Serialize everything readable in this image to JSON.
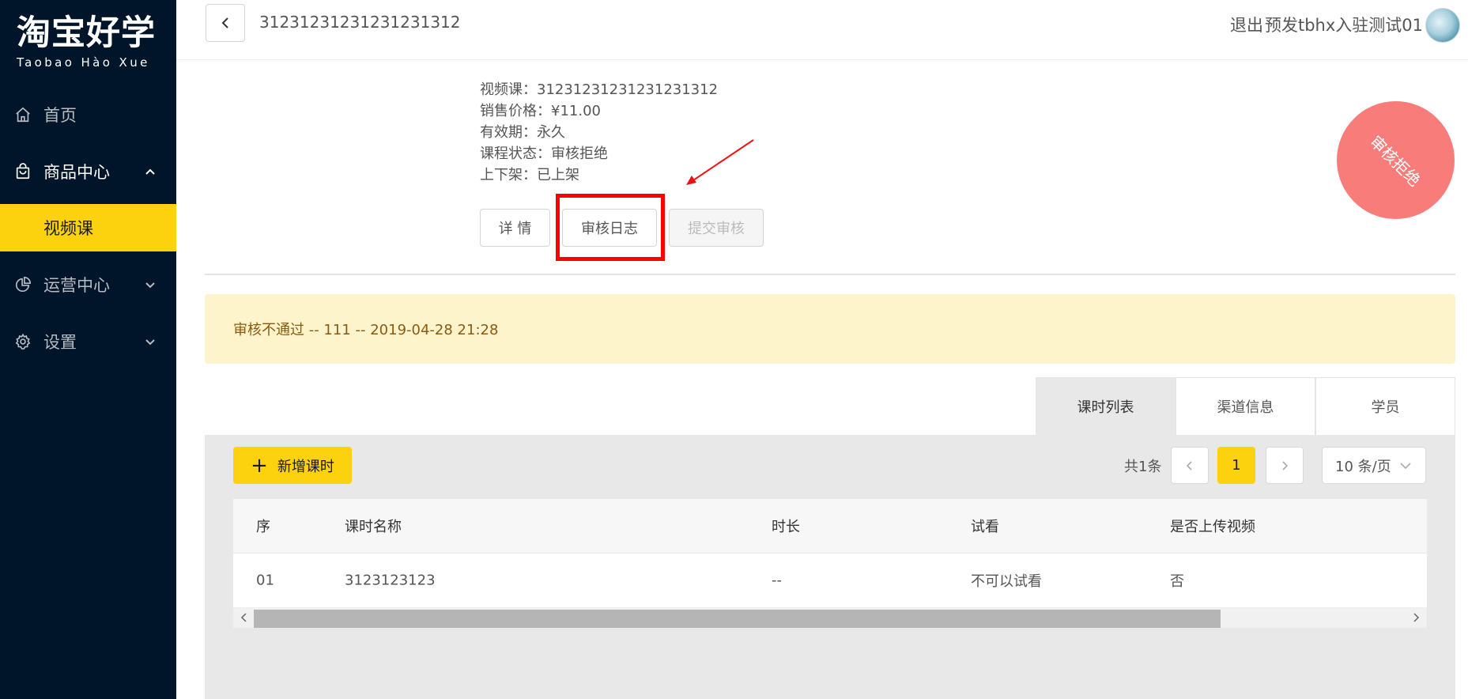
{
  "logo": {
    "cn": "淘宝好学",
    "en": "Taobao Hào Xue"
  },
  "sidebar": {
    "items": [
      {
        "label": "首页",
        "icon": "home-icon"
      },
      {
        "label": "商品中心",
        "icon": "shopping-bag-icon",
        "expanded": true
      },
      {
        "label": "运营中心",
        "icon": "pie-chart-icon"
      },
      {
        "label": "设置",
        "icon": "gear-icon"
      }
    ],
    "sub_items": [
      {
        "label": "视频课",
        "active": true
      }
    ]
  },
  "header": {
    "title": "31231231231231231312",
    "logout": "退出",
    "username": "预发tbhx入驻测试01"
  },
  "course": {
    "name": "视频课：31231231231231231312",
    "price": "销售价格：¥11.00",
    "validity": "有效期：永久",
    "status": "课程状态：审核拒绝",
    "shelf": "上下架：已上架"
  },
  "actions": {
    "detail": "详 情",
    "audit_log": "审核日志",
    "submit": "提交审核"
  },
  "stamp": "审核拒绝",
  "alert": "审核不通过 -- 111 -- 2019-04-28 21:28",
  "tabs": [
    "课时列表",
    "渠道信息",
    "学员"
  ],
  "toolbar": {
    "add_label": "新增课时"
  },
  "pagination": {
    "total": "共1条",
    "current": "1",
    "page_size": "10 条/页"
  },
  "table": {
    "columns": [
      "序",
      "课时名称",
      "时长",
      "试看",
      "是否上传视频"
    ],
    "rows": [
      [
        "01",
        "3123123123",
        "--",
        "不可以试看",
        "否"
      ]
    ]
  },
  "colors": {
    "sidebar_bg": "#001529",
    "accent": "#fcd20f",
    "stamp": "#f87c7a",
    "alert_bg": "#fef4cc",
    "highlight": "#ff0000"
  }
}
